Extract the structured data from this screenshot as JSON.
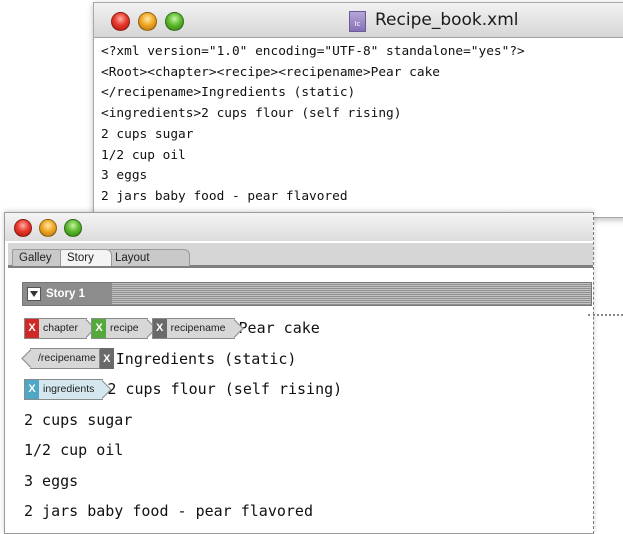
{
  "back_window": {
    "title": "Recipe_book.xml",
    "file_icon_text": "Ic",
    "lines": [
      "<?xml version=\"1.0\" encoding=\"UTF-8\" standalone=\"yes\"?>",
      "<Root><chapter><recipe><recipename>Pear cake",
      "</recipename>Ingredients (static)",
      "<ingredients>2 cups flour (self rising)",
      "2 cups sugar",
      "1/2 cup oil",
      "3 eggs",
      "2 jars baby food - pear flavored"
    ]
  },
  "front_window": {
    "tabs": [
      "Galley",
      "Story",
      "Layout"
    ],
    "active_tab": "Story",
    "story_label": "Story 1",
    "tags": {
      "chapter": "chapter",
      "recipe": "recipe",
      "recipename": "recipename",
      "recipename_close": "/recipename",
      "ingredients": "ingredients",
      "x_glyph": "X"
    },
    "text": {
      "line1": "Pear cake",
      "line2": "Ingredients (static)",
      "line3": "2 cups flour (self rising)",
      "line4": "2 cups sugar",
      "line5": "1/2 cup oil",
      "line6": "3 eggs",
      "line7": "2 jars baby food - pear flavored"
    },
    "tag_colors": {
      "chapter": "#cf2a27",
      "recipe": "#55a93a",
      "recipename": "#6a6a6a",
      "ingredients": "#4fa7c6"
    }
  }
}
